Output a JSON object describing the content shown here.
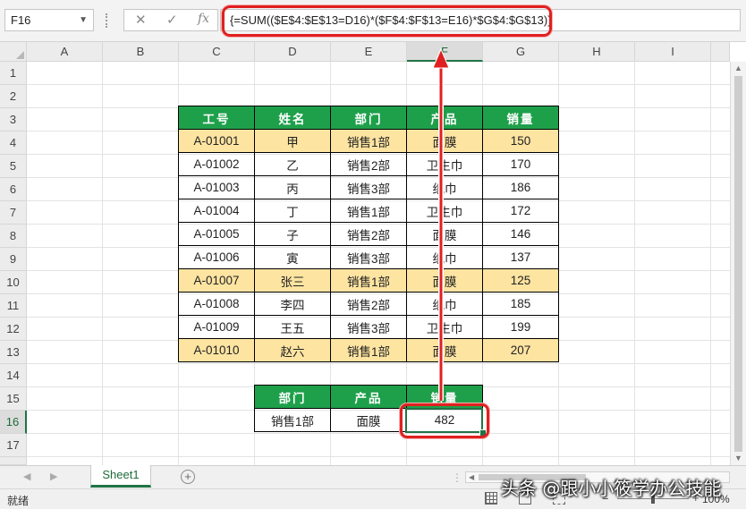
{
  "formula_bar": {
    "name_box": "F16",
    "cancel_glyph": "✕",
    "enter_glyph": "✓",
    "fx_label": "fx",
    "formula": "{=SUM(($E$4:$E$13=D16)*($F$4:$F$13=E16)*$G$4:$G$13)}"
  },
  "columns": [
    "A",
    "B",
    "C",
    "D",
    "E",
    "F",
    "G",
    "H",
    "I"
  ],
  "rows": [
    "1",
    "2",
    "3",
    "4",
    "5",
    "6",
    "7",
    "8",
    "9",
    "10",
    "11",
    "12",
    "13",
    "14",
    "15",
    "16",
    "17"
  ],
  "selected_cell": {
    "column": "F",
    "row": "16"
  },
  "table": {
    "headers": [
      "工号",
      "姓名",
      "部门",
      "产品",
      "销量"
    ],
    "rows": [
      {
        "id": "A-01001",
        "name": "甲",
        "dept": "销售1部",
        "product": "面膜",
        "sales": "150",
        "highlight": true
      },
      {
        "id": "A-01002",
        "name": "乙",
        "dept": "销售2部",
        "product": "卫生巾",
        "sales": "170",
        "highlight": false
      },
      {
        "id": "A-01003",
        "name": "丙",
        "dept": "销售3部",
        "product": "纸巾",
        "sales": "186",
        "highlight": false
      },
      {
        "id": "A-01004",
        "name": "丁",
        "dept": "销售1部",
        "product": "卫生巾",
        "sales": "172",
        "highlight": false
      },
      {
        "id": "A-01005",
        "name": "子",
        "dept": "销售2部",
        "product": "面膜",
        "sales": "146",
        "highlight": false
      },
      {
        "id": "A-01006",
        "name": "寅",
        "dept": "销售3部",
        "product": "纸巾",
        "sales": "137",
        "highlight": false
      },
      {
        "id": "A-01007",
        "name": "张三",
        "dept": "销售1部",
        "product": "面膜",
        "sales": "125",
        "highlight": true
      },
      {
        "id": "A-01008",
        "name": "李四",
        "dept": "销售2部",
        "product": "纸巾",
        "sales": "185",
        "highlight": false
      },
      {
        "id": "A-01009",
        "name": "王五",
        "dept": "销售3部",
        "product": "卫生巾",
        "sales": "199",
        "highlight": false
      },
      {
        "id": "A-01010",
        "name": "赵六",
        "dept": "销售1部",
        "product": "面膜",
        "sales": "207",
        "highlight": true
      }
    ]
  },
  "summary": {
    "headers": [
      "部门",
      "产品",
      "销量"
    ],
    "dept": "销售1部",
    "product": "面膜",
    "result": "482"
  },
  "sheet_tabs": {
    "active": "Sheet1",
    "add_glyph": "+"
  },
  "status": {
    "text": "就绪",
    "zoom": "100%"
  },
  "watermark": "头条 @跟小小筱学办公技能",
  "colors": {
    "header_green": "#1ea04b",
    "highlight_yellow": "#fde4a1",
    "annotation_red": "#e02020",
    "excel_green": "#217346"
  }
}
